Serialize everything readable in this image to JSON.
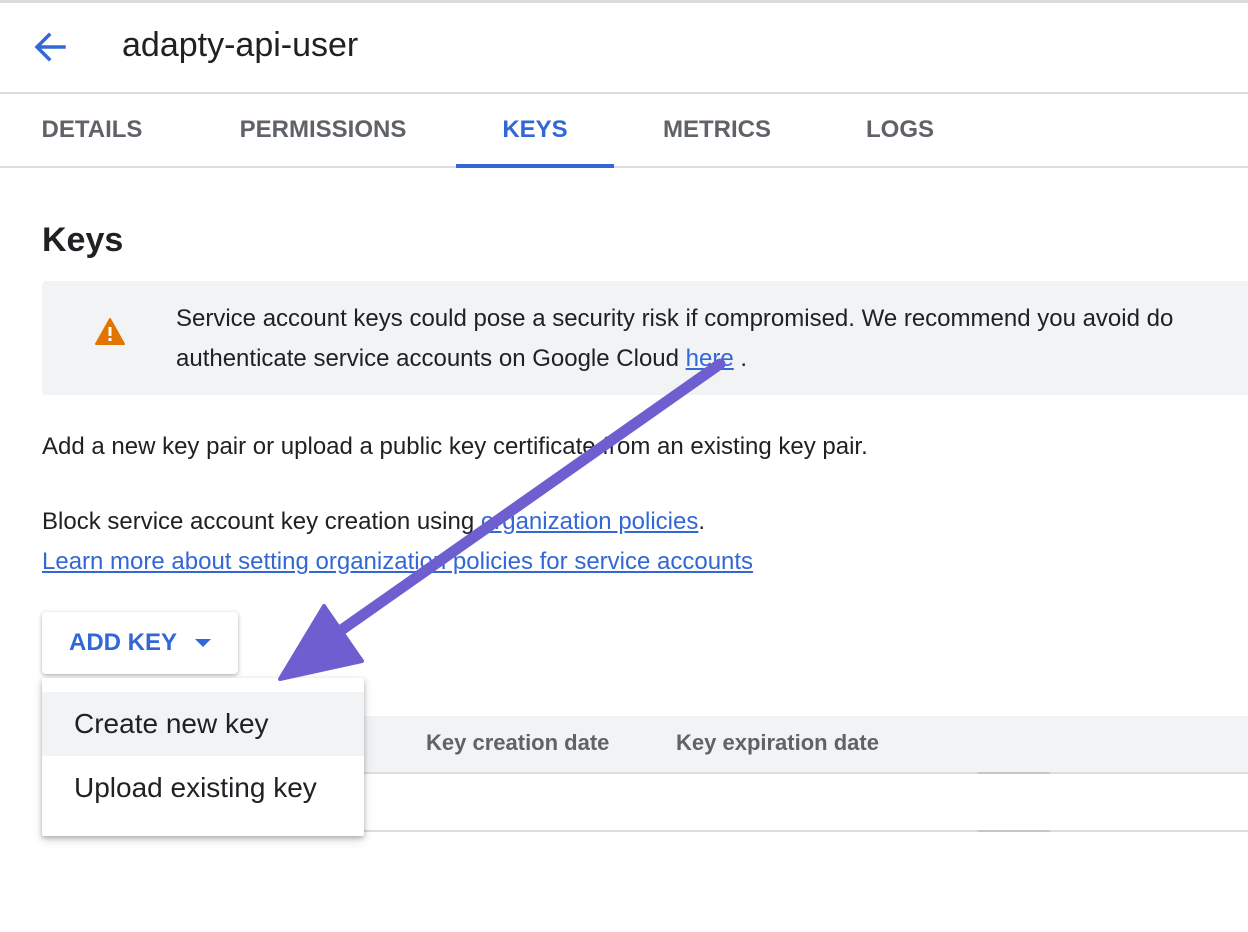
{
  "header": {
    "title": "adapty-api-user",
    "back_icon": "arrow-left-icon"
  },
  "tabs": [
    {
      "label": "DETAILS",
      "active": false
    },
    {
      "label": "PERMISSIONS",
      "active": false
    },
    {
      "label": "KEYS",
      "active": true
    },
    {
      "label": "METRICS",
      "active": false
    },
    {
      "label": "LOGS",
      "active": false
    }
  ],
  "keys_section": {
    "title": "Keys",
    "warning": {
      "icon": "warning-triangle-icon",
      "line1": "Service account keys could pose a security risk if compromised. We recommend you avoid do",
      "line2_prefix": "authenticate service accounts on Google Cloud ",
      "link_text": "here",
      "line2_suffix": " ."
    },
    "intro_text": "Add a new key pair or upload a public key certificate from an existing key pair.",
    "block_text_prefix": "Block service account key creation using ",
    "block_link": "organization policies",
    "block_text_suffix": ".",
    "learn_more_link": "Learn more about setting organization policies for service accounts",
    "add_key_button": "ADD KEY",
    "add_key_menu": [
      {
        "label": "Create new key"
      },
      {
        "label": "Upload existing key"
      }
    ],
    "table": {
      "columns": [
        "Key creation date",
        "Key expiration date"
      ]
    }
  },
  "colors": {
    "accent": "#3367d6",
    "warning": "#e37400",
    "annotation_arrow": "#6e5fd0"
  }
}
